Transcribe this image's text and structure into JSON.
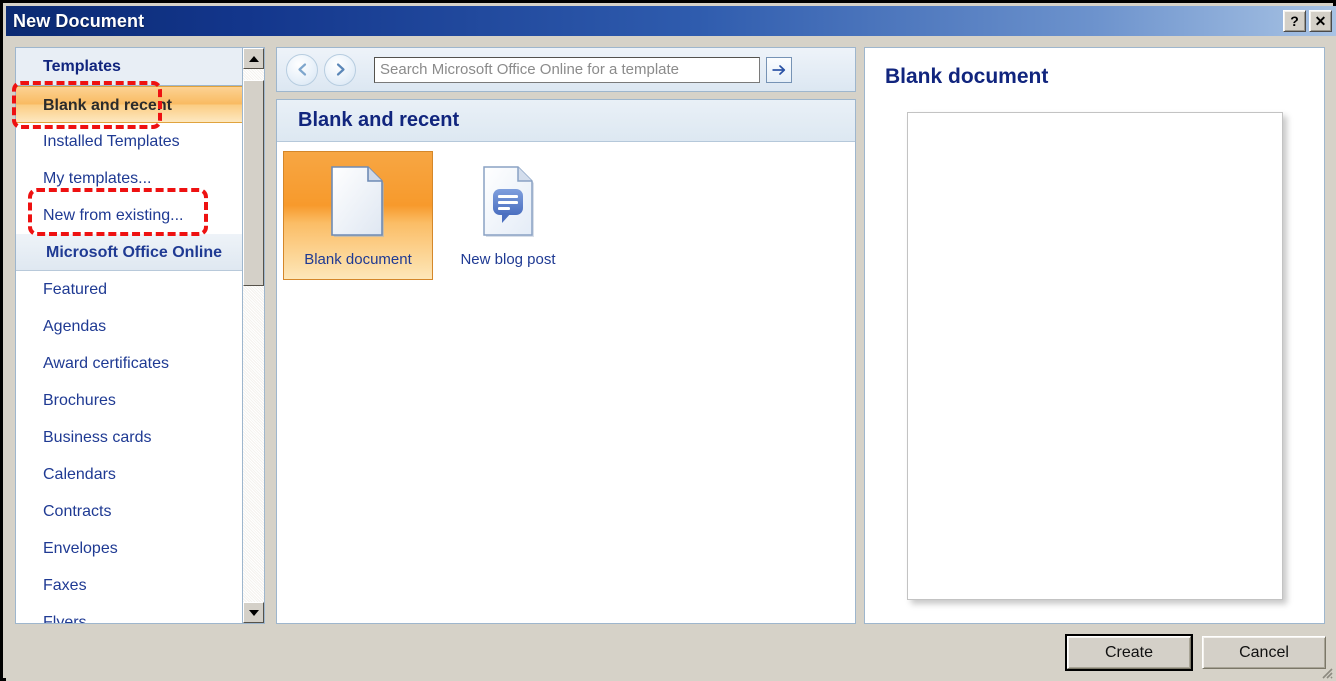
{
  "window": {
    "title": "New Document",
    "help_button": "?",
    "close_button": "✕"
  },
  "sidebar": {
    "items": [
      {
        "label": "Templates",
        "role": "header"
      },
      {
        "label": "Blank and recent",
        "role": "selected"
      },
      {
        "label": "Installed Templates",
        "role": "item"
      },
      {
        "label": "My templates...",
        "role": "item"
      },
      {
        "label": "New from existing...",
        "role": "item"
      },
      {
        "label": "Microsoft Office Online",
        "role": "grouptitle"
      },
      {
        "label": "Featured",
        "role": "item"
      },
      {
        "label": "Agendas",
        "role": "item"
      },
      {
        "label": "Award certificates",
        "role": "item"
      },
      {
        "label": "Brochures",
        "role": "item"
      },
      {
        "label": "Business cards",
        "role": "item"
      },
      {
        "label": "Calendars",
        "role": "item"
      },
      {
        "label": "Contracts",
        "role": "item"
      },
      {
        "label": "Envelopes",
        "role": "item"
      },
      {
        "label": "Faxes",
        "role": "item"
      },
      {
        "label": "Flyers",
        "role": "item"
      }
    ],
    "scroll_up_icon": "triangle-up",
    "scroll_down_icon": "triangle-down"
  },
  "toolbar": {
    "back_icon": "arrow-left-circle",
    "forward_icon": "arrow-right-circle",
    "search_placeholder": "Search Microsoft Office Online for a template",
    "search_value": "",
    "search_go_icon": "arrow-right"
  },
  "gallery": {
    "header": "Blank and recent",
    "tiles": [
      {
        "label": "Blank document",
        "icon": "blank-document-icon",
        "selected": true
      },
      {
        "label": "New blog post",
        "icon": "blog-post-document-icon",
        "selected": false
      }
    ]
  },
  "preview": {
    "title": "Blank document",
    "page_icon": "blank-page-preview"
  },
  "footer": {
    "create_label": "Create",
    "cancel_label": "Cancel",
    "resize_grip_icon": "resize-grip-icon"
  },
  "annotations": [
    {
      "name": "templates-highlight",
      "target": "Templates",
      "color": "#ee1111",
      "style": "dashed-rounded-rectangle"
    },
    {
      "name": "my-templates-highlight",
      "target": "My templates...",
      "color": "#ee1111",
      "style": "dashed-rounded-rectangle"
    }
  ],
  "colors": {
    "titlebar_start": "#0b2a72",
    "titlebar_end": "#a8c3e4",
    "accent_selected": "#f79a2c",
    "link_text": "#1f3a93",
    "annotation_red": "#ee1111",
    "dialog_face": "#d6d2c8"
  }
}
